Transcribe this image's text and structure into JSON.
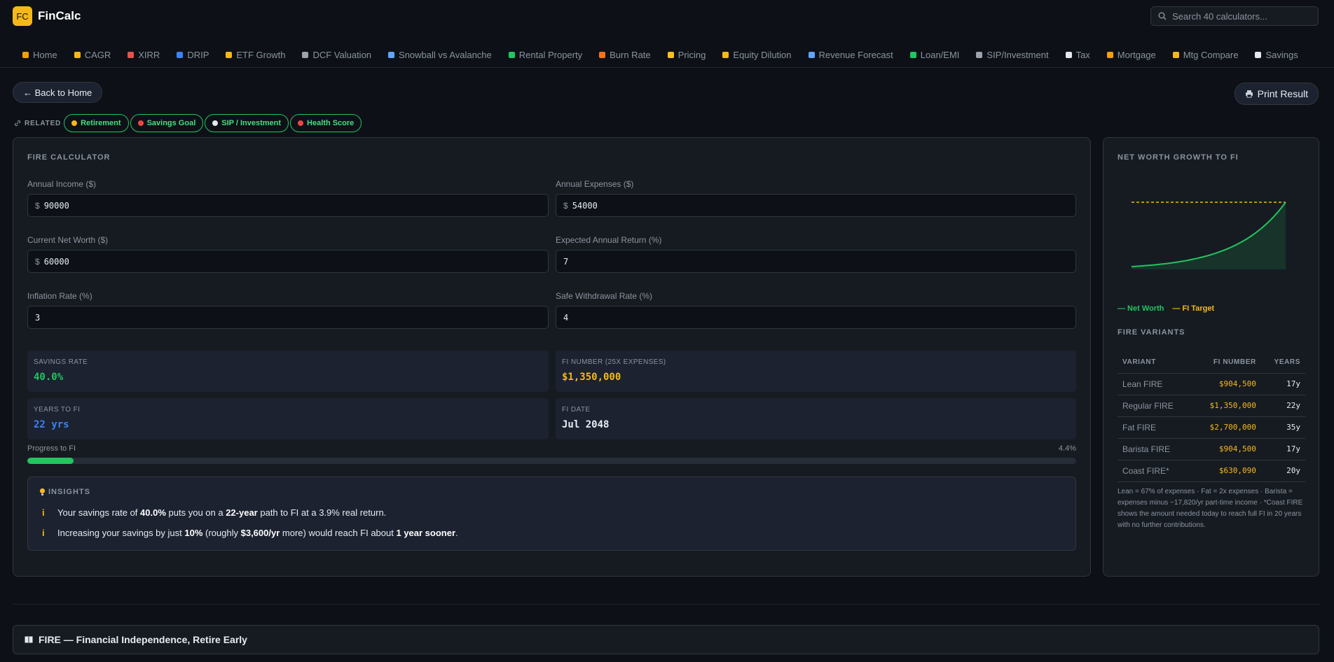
{
  "app": {
    "logo_initials": "FC",
    "name": "FinCalc",
    "search_placeholder": "Search 40 calculators..."
  },
  "nav": [
    {
      "label": "Home",
      "icon": "home-icon",
      "color": "#f59e0b"
    },
    {
      "label": "CAGR",
      "icon": "ruler-icon",
      "color": "#f5b81b"
    },
    {
      "label": "XIRR",
      "icon": "calendar-icon",
      "color": "#e5534b"
    },
    {
      "label": "DRIP",
      "icon": "droplet-icon",
      "color": "#3b82f6"
    },
    {
      "label": "ETF Growth",
      "icon": "chart-icon",
      "color": "#f5b81b"
    },
    {
      "label": "DCF Valuation",
      "icon": "document-icon",
      "color": "#9ca3af"
    },
    {
      "label": "Snowball vs Avalanche",
      "icon": "snowflake-icon",
      "color": "#60a5fa"
    },
    {
      "label": "Rental Property",
      "icon": "house-icon",
      "color": "#22c55e"
    },
    {
      "label": "Burn Rate",
      "icon": "fire-icon",
      "color": "#f97316"
    },
    {
      "label": "Pricing",
      "icon": "tag-icon",
      "color": "#fbbf24"
    },
    {
      "label": "Equity Dilution",
      "icon": "ruler-icon",
      "color": "#f5b81b"
    },
    {
      "label": "Revenue Forecast",
      "icon": "bar-chart-icon",
      "color": "#60a5fa"
    },
    {
      "label": "Loan/EMI",
      "icon": "document-icon",
      "color": "#22c55e"
    },
    {
      "label": "SIP/Investment",
      "icon": "trend-icon",
      "color": "#9ca3af"
    },
    {
      "label": "Tax",
      "icon": "receipt-icon",
      "color": "#e5e7eb"
    },
    {
      "label": "Mortgage",
      "icon": "house-icon",
      "color": "#f59e0b"
    },
    {
      "label": "Mtg Compare",
      "icon": "scale-icon",
      "color": "#f5b81b"
    },
    {
      "label": "Savings",
      "icon": "bank-icon",
      "color": "#e5e7eb"
    }
  ],
  "buttons": {
    "back": "← Back to Home",
    "print": "Print Result"
  },
  "related": {
    "label": "RELATED",
    "items": [
      {
        "label": "Retirement",
        "color": "#f5b81b"
      },
      {
        "label": "Savings Goal",
        "color": "#ef4444"
      },
      {
        "label": "SIP / Investment",
        "color": "#e5e7eb"
      },
      {
        "label": "Health Score",
        "color": "#ef4444"
      }
    ]
  },
  "calculator": {
    "title": "FIRE CALCULATOR",
    "fields": {
      "annual_income": {
        "label": "Annual Income ($)",
        "prefix": "$",
        "value": "90000"
      },
      "annual_expenses": {
        "label": "Annual Expenses ($)",
        "prefix": "$",
        "value": "54000"
      },
      "net_worth": {
        "label": "Current Net Worth ($)",
        "prefix": "$",
        "value": "60000"
      },
      "annual_return": {
        "label": "Expected Annual Return (%)",
        "value": "7"
      },
      "inflation": {
        "label": "Inflation Rate (%)",
        "value": "3"
      },
      "withdrawal": {
        "label": "Safe Withdrawal Rate (%)",
        "value": "4"
      }
    },
    "stats": {
      "savings_rate": {
        "label": "SAVINGS RATE",
        "value": "40.0%",
        "color": "#22c55e"
      },
      "fi_number": {
        "label": "FI NUMBER (25X EXPENSES)",
        "value": "$1,350,000",
        "color": "#f5b81b"
      },
      "years_to_fi": {
        "label": "YEARS TO FI",
        "value": "22 yrs",
        "color": "#3b82f6"
      },
      "fi_date": {
        "label": "FI DATE",
        "value": "Jul 2048",
        "color": "#e6edf3"
      }
    },
    "progress": {
      "label": "Progress to FI",
      "pct_text": "4.4%",
      "fraction": 0.044
    },
    "insights": {
      "title": "INSIGHTS",
      "line1": {
        "a": "Your savings rate of ",
        "b": "40.0%",
        "c": " puts you on a ",
        "d": "22-year",
        "e": " path to FI at a 3.9% real return."
      },
      "line2": {
        "a": "Increasing your savings by just ",
        "b": "10%",
        "c": " (roughly ",
        "d": "$3,600/yr",
        "e": " more) would reach FI about ",
        "f": "1 year sooner",
        "g": "."
      }
    }
  },
  "side": {
    "chart_title": "NET WORTH GROWTH TO FI",
    "legend": {
      "net_worth": "— Net Worth",
      "fi_target": "— FI Target"
    },
    "variants_title": "FIRE VARIANTS",
    "headers": {
      "variant": "VARIANT",
      "fi_number": "FI NUMBER",
      "years": "YEARS"
    },
    "rows": [
      {
        "variant": "Lean FIRE",
        "fi_number": "$904,500",
        "years": "17y"
      },
      {
        "variant": "Regular FIRE",
        "fi_number": "$1,350,000",
        "years": "22y"
      },
      {
        "variant": "Fat FIRE",
        "fi_number": "$2,700,000",
        "years": "35y"
      },
      {
        "variant": "Barista FIRE",
        "fi_number": "$904,500",
        "years": "17y"
      },
      {
        "variant": "Coast FIRE*",
        "fi_number": "$630,090",
        "years": "20y"
      }
    ],
    "note": "Lean = 67% of expenses · Fat = 2x expenses · Barista = expenses minus ~17,820/yr part-time income · *Coast FIRE shows the amount needed today to reach full FI in 20 years with no further contributions."
  },
  "chart_data": {
    "type": "line",
    "title": "NET WORTH GROWTH TO FI",
    "x": [
      0,
      22
    ],
    "series": [
      {
        "name": "Net Worth",
        "color": "#22c55e"
      },
      {
        "name": "FI Target",
        "color": "#f5b81b",
        "values": [
          1350000,
          1350000
        ]
      }
    ],
    "start_value": 60000,
    "end_value": 1350000
  },
  "footer": {
    "section_title": "FIRE — Financial Independence, Retire Early"
  }
}
